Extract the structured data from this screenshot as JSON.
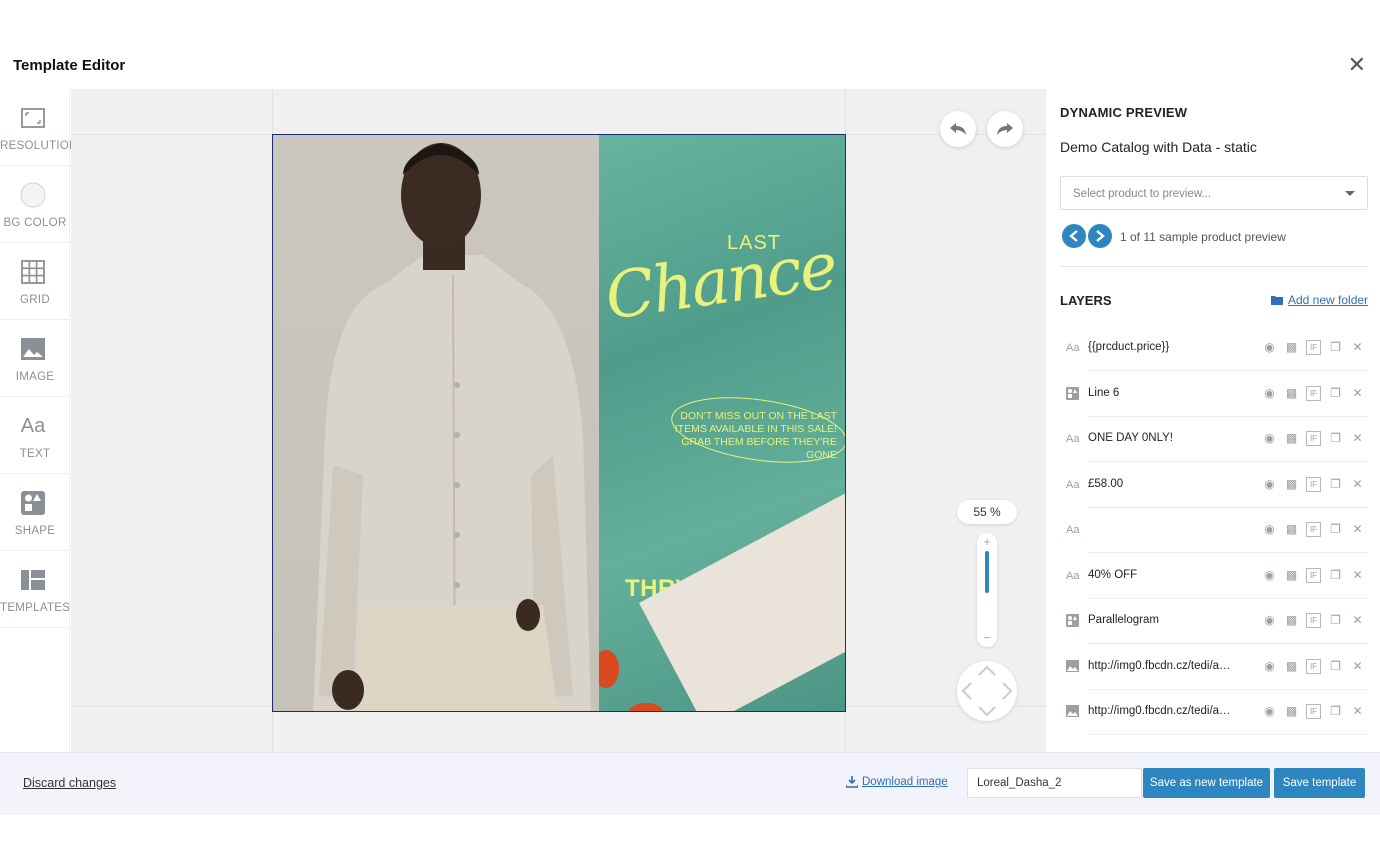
{
  "window": {
    "title": "Template Editor",
    "close_label": "✕"
  },
  "toolbar": {
    "items": [
      {
        "label": "RESOLUTION",
        "icon": "resolution-icon"
      },
      {
        "label": "BG COLOR",
        "icon": "bg-color-icon"
      },
      {
        "label": "GRID",
        "icon": "grid-icon"
      },
      {
        "label": "IMAGE",
        "icon": "image-icon"
      },
      {
        "label": "TEXT",
        "icon": "text-icon",
        "glyph": "Aa"
      },
      {
        "label": "SHAPE",
        "icon": "shape-icon"
      },
      {
        "label": "TEMPLATES",
        "icon": "templates-icon"
      }
    ]
  },
  "canvas": {
    "zoom_label": "55 %",
    "zoom_level": 0.55,
    "artwork": {
      "last": "LAST",
      "chance": "Chance",
      "description": "DON'T MISS OUT ON THE LAST ITEMS AVAILABLE IN THIS SALE! GRAB THEM BEFORE THEY'RE GONE",
      "brand": "THRYFT & CO.",
      "promo_color": "#e9f27a"
    }
  },
  "panel": {
    "preview_heading": "DYNAMIC PREVIEW",
    "catalog_name": "Demo Catalog with Data - static",
    "select_placeholder": "Select product to preview...",
    "preview_count": "1 of 11 sample product preview",
    "layers_heading": "LAYERS",
    "add_folder_label": "Add new folder",
    "layers": [
      {
        "type": "text",
        "icon_glyph": "Aa",
        "name": "{{prcduct.price}}"
      },
      {
        "type": "shape",
        "icon_glyph": "",
        "name": "Line 6"
      },
      {
        "type": "text",
        "icon_glyph": "Aa",
        "name": "ONE DAY 0NLY!"
      },
      {
        "type": "text",
        "icon_glyph": "Aa",
        "name": "£58.00"
      },
      {
        "type": "text",
        "icon_glyph": "Aa",
        "name": ""
      },
      {
        "type": "text",
        "icon_glyph": "Aa",
        "name": "40% OFF"
      },
      {
        "type": "shape",
        "icon_glyph": "",
        "name": "Parallelogram"
      },
      {
        "type": "image",
        "icon_glyph": "",
        "name": "http://img0.fbcdn.cz/tedi/api/..."
      },
      {
        "type": "image",
        "icon_glyph": "",
        "name": "http://img0.fbcdn.cz/tedi/api/..."
      }
    ],
    "layer_actions": [
      "eye-icon",
      "opacity-icon",
      "if-icon",
      "duplicate-icon",
      "delete-icon"
    ]
  },
  "footer": {
    "discard_label": "Discard changes",
    "download_label": "Download image",
    "template_name": "Loreal_Dasha_2",
    "save_new_label": "Save as new template",
    "save_label": "Save template"
  },
  "colors": {
    "accent": "#2e86c1",
    "link": "#2e6fb5",
    "footer_bg": "#f3f4fb"
  }
}
